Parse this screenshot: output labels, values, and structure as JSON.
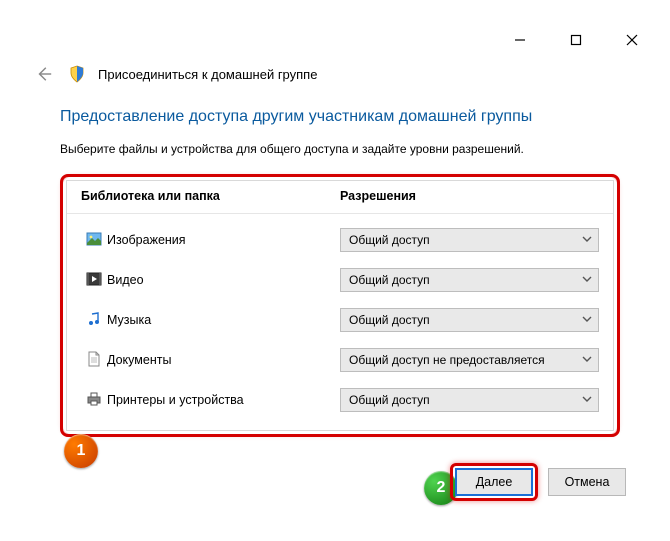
{
  "window": {
    "title": "Присоединиться к домашней группе"
  },
  "section": {
    "heading": "Предоставление доступа другим участникам домашней группы",
    "subtext": "Выберите файлы и устройства для общего доступа и задайте уровни разрешений."
  },
  "columns": {
    "library": "Библиотека или папка",
    "permission": "Разрешения"
  },
  "rows": {
    "pictures": {
      "label": "Изображения",
      "value": "Общий доступ"
    },
    "videos": {
      "label": "Видео",
      "value": "Общий доступ"
    },
    "music": {
      "label": "Музыка",
      "value": "Общий доступ"
    },
    "docs": {
      "label": "Документы",
      "value": "Общий доступ не предоставляется"
    },
    "printers": {
      "label": "Принтеры и устройства",
      "value": "Общий доступ"
    }
  },
  "buttons": {
    "next": "Далее",
    "cancel": "Отмена"
  },
  "badges": {
    "one": "1",
    "two": "2"
  }
}
